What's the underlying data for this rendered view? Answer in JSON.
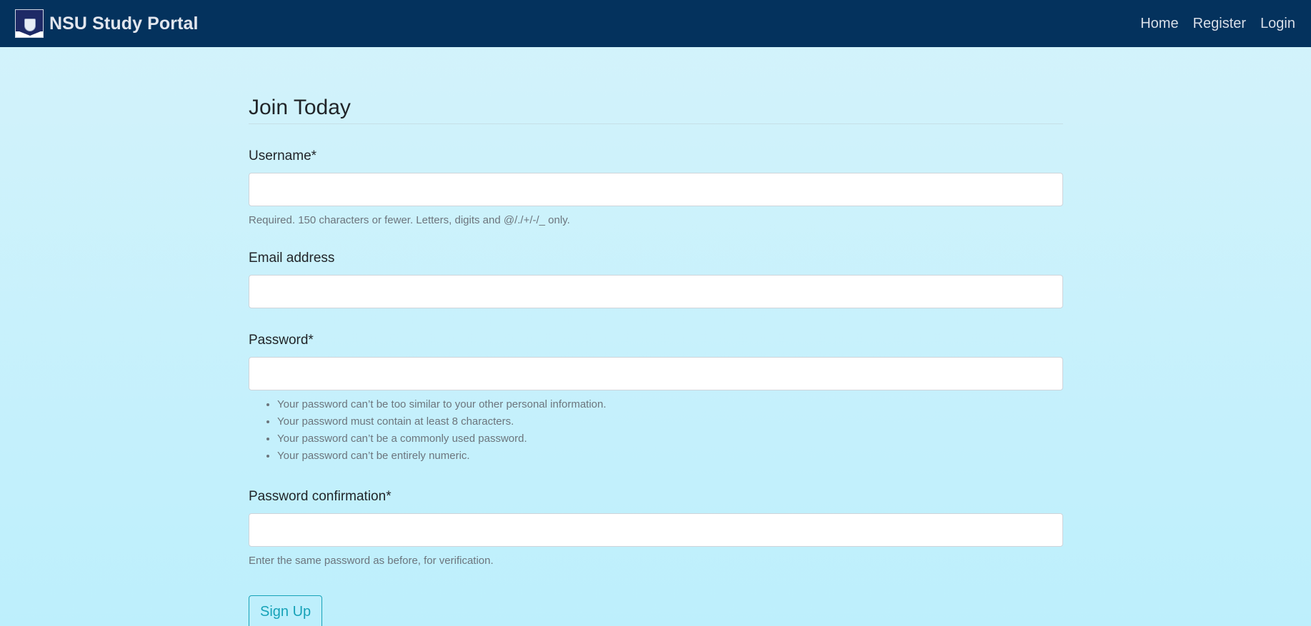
{
  "navbar": {
    "brand": "NSU Study Portal",
    "logo_icon": "nsu-crest-logo",
    "links": [
      "Home",
      "Register",
      "Login"
    ]
  },
  "form": {
    "title": "Join Today",
    "username": {
      "label": "Username*",
      "value": "",
      "help": "Required. 150 characters or fewer. Letters, digits and @/./+/-/_ only."
    },
    "email": {
      "label": "Email address",
      "value": ""
    },
    "password": {
      "label": "Password*",
      "value": "",
      "rules": [
        "Your password can’t be too similar to your other personal information.",
        "Your password must contain at least 8 characters.",
        "Your password can’t be a commonly used password.",
        "Your password can’t be entirely numeric."
      ]
    },
    "password_confirmation": {
      "label": "Password confirmation*",
      "value": "",
      "help": "Enter the same password as before, for verification."
    },
    "submit_label": "Sign Up"
  },
  "colors": {
    "navbar_bg": "#04325d",
    "page_bg": "#c9f1fb",
    "button_accent": "#17a2b8"
  }
}
